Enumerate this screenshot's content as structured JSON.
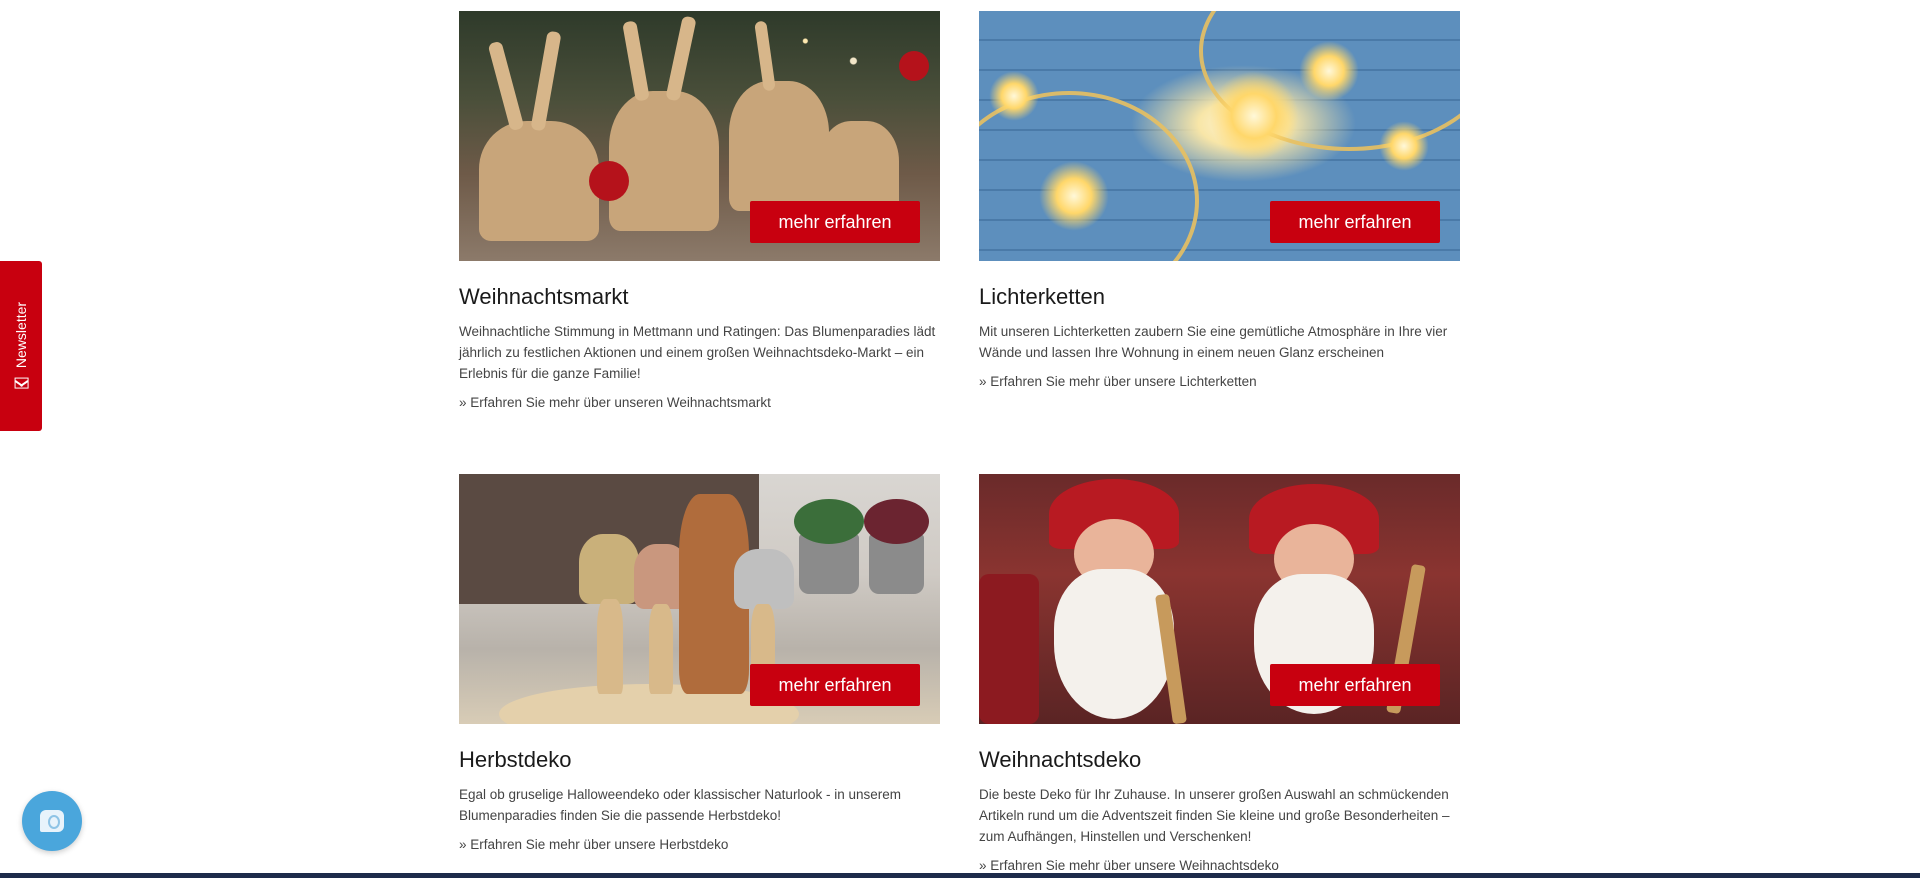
{
  "newsletter": {
    "label": "Newsletter",
    "icon": "mail-icon"
  },
  "chat": {
    "icon": "chat-icon"
  },
  "accent_color": "#c8000f",
  "cards": [
    {
      "title": "Weihnachtsmarkt",
      "text": "Weihnachtliche Stimmung in Mettmann und Ratingen: Das Blumenparadies lädt jährlich zu festlichen Aktionen und einem großen Weihnachtsdeko-Markt – ein Erlebnis für die ganze Familie!",
      "link": "» Erfahren Sie mehr über unseren Weihnachtsmarkt",
      "button": "mehr erfahren"
    },
    {
      "title": "Lichterketten",
      "text": "Mit unseren Lichterketten zaubern Sie eine gemütliche Atmosphäre in Ihre vier Wände und lassen Ihre Wohnung in einem neuen Glanz erscheinen",
      "link": "» Erfahren Sie mehr über unsere Lichterketten",
      "button": "mehr erfahren"
    },
    {
      "title": "Herbstdeko",
      "text": "Egal ob gruselige Halloweendeko oder klassischer Naturlook - in unserem Blumenparadies finden Sie die passende Herbstdeko!",
      "link": "» Erfahren Sie mehr über unsere Herbstdeko",
      "button": "mehr erfahren"
    },
    {
      "title": "Weihnachtsdeko",
      "text": "Die beste Deko für Ihr Zuhause. In unserer großen Auswahl an schmückenden Artikeln rund um die Adventszeit finden Sie kleine und große Besonderheiten – zum Aufhängen, Hinstellen und Verschenken!",
      "link": "» Erfahren Sie mehr über unsere Weihnachtsdeko",
      "button": "mehr erfahren"
    }
  ]
}
